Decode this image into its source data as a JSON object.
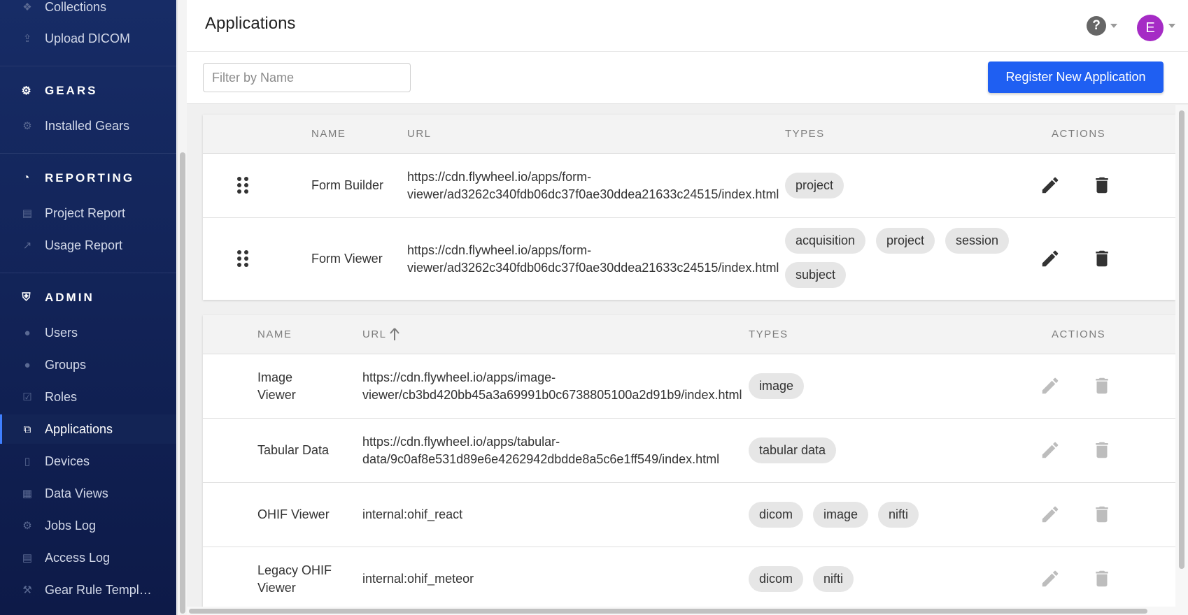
{
  "sidebar": {
    "items_top": [
      {
        "label": "Collections",
        "icon": "collections-icon"
      },
      {
        "label": "Upload DICOM",
        "icon": "upload-icon"
      }
    ],
    "gears": {
      "title": "GEARS",
      "icon": "gear-icon",
      "items": [
        {
          "label": "Installed Gears",
          "icon": "gear-icon"
        }
      ]
    },
    "reporting": {
      "title": "REPORTING",
      "icon": "pie-chart-icon",
      "items": [
        {
          "label": "Project Report",
          "icon": "bar-chart-icon"
        },
        {
          "label": "Usage Report",
          "icon": "line-chart-icon"
        }
      ]
    },
    "admin": {
      "title": "ADMIN",
      "icon": "shield-icon",
      "items": [
        {
          "label": "Users",
          "icon": "user-icon"
        },
        {
          "label": "Groups",
          "icon": "users-icon"
        },
        {
          "label": "Roles",
          "icon": "check-square-icon"
        },
        {
          "label": "Applications",
          "icon": "windows-icon",
          "active": true
        },
        {
          "label": "Devices",
          "icon": "tablet-icon"
        },
        {
          "label": "Data Views",
          "icon": "table-icon"
        },
        {
          "label": "Jobs Log",
          "icon": "cogs-icon"
        },
        {
          "label": "Access Log",
          "icon": "file-icon"
        },
        {
          "label": "Gear Rule Templ…",
          "icon": "gavel-icon"
        }
      ]
    }
  },
  "header": {
    "title": "Applications",
    "avatar_letter": "E",
    "avatar_color": "#a52bc5"
  },
  "toolbar": {
    "filter_placeholder": "Filter by Name",
    "register_label": "Register New Application",
    "accent": "#1f5ff2"
  },
  "table1": {
    "headers": {
      "name": "NAME",
      "url": "URL",
      "types": "TYPES",
      "actions": "ACTIONS"
    },
    "rows": [
      {
        "name": "Form Builder",
        "url_line1": "https://cdn.flywheel.io/apps/form-",
        "url_line2": "viewer/ad3262c340fdb06dc37f0ae30ddea21633c24515/index.html",
        "types": [
          "project"
        ]
      },
      {
        "name": "Form Viewer",
        "url_line1": "https://cdn.flywheel.io/apps/form-",
        "url_line2": "viewer/ad3262c340fdb06dc37f0ae30ddea21633c24515/index.html",
        "types": [
          "acquisition",
          "project",
          "session",
          "subject"
        ]
      }
    ]
  },
  "table2": {
    "headers": {
      "name": "NAME",
      "url": "URL",
      "types": "TYPES",
      "actions": "ACTIONS"
    },
    "rows": [
      {
        "name_line1": "Image",
        "name_line2": "Viewer",
        "url_line1": "https://cdn.flywheel.io/apps/image-",
        "url_line2": "viewer/cb3bd420bb45a3a69991b0c6738805100a2d91b9/index.html",
        "types": [
          "image"
        ]
      },
      {
        "name_line1": "Tabular Data",
        "name_line2": "",
        "url_line1": "https://cdn.flywheel.io/apps/tabular-",
        "url_line2": "data/9c0af8e531d89e6e4262942dbdde8a5c6e1ff549/index.html",
        "types": [
          "tabular data"
        ]
      },
      {
        "name_line1": "OHIF Viewer",
        "name_line2": "",
        "url_line1": "internal:ohif_react",
        "url_line2": "",
        "types": [
          "dicom",
          "image",
          "nifti"
        ]
      },
      {
        "name_line1": "Legacy OHIF",
        "name_line2": "Viewer",
        "url_line1": "internal:ohif_meteor",
        "url_line2": "",
        "types": [
          "dicom",
          "nifti"
        ]
      }
    ]
  }
}
